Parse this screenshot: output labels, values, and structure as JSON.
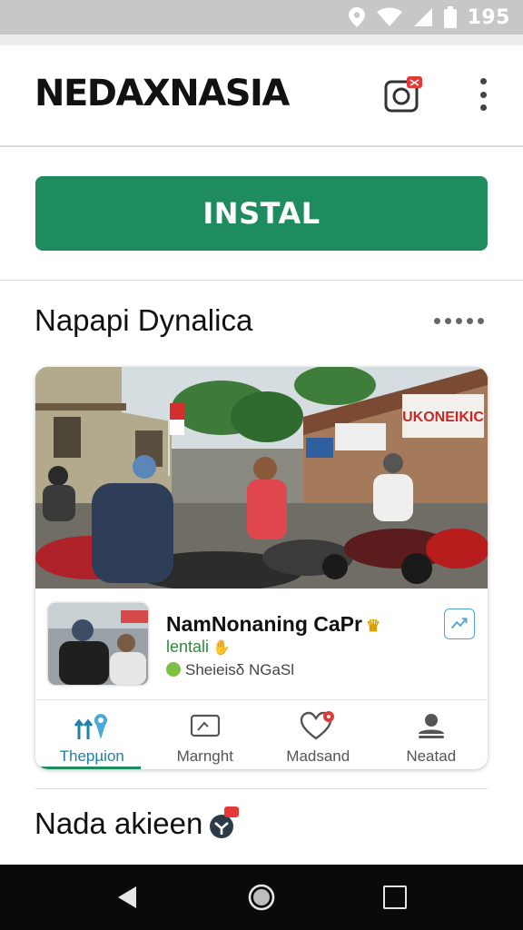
{
  "status_bar": {
    "time": "195"
  },
  "header": {
    "title": "NEDAXNASIA"
  },
  "install": {
    "label": "INSTAL"
  },
  "section": {
    "title": "Napapi Dynalica"
  },
  "card": {
    "name": "NamNonaning CaPr",
    "subtitle": "lentali",
    "meta": "Sheieisδ NGaSl",
    "banner_text": "UKONEIKIC",
    "tabs": [
      {
        "label": "Thepµion",
        "icon": "people-pin-icon",
        "active": true
      },
      {
        "label": "Marnght",
        "icon": "picture-frame-icon",
        "active": false
      },
      {
        "label": "Madsand",
        "icon": "heart-icon",
        "active": false
      },
      {
        "label": "Neatad",
        "icon": "person-icon",
        "active": false
      }
    ]
  },
  "bottom_section": {
    "title": "Nada akieen"
  },
  "colors": {
    "accent_green": "#1e8c5f",
    "active_tab_blue": "#1e7fa8",
    "notification_red": "#e53935"
  }
}
